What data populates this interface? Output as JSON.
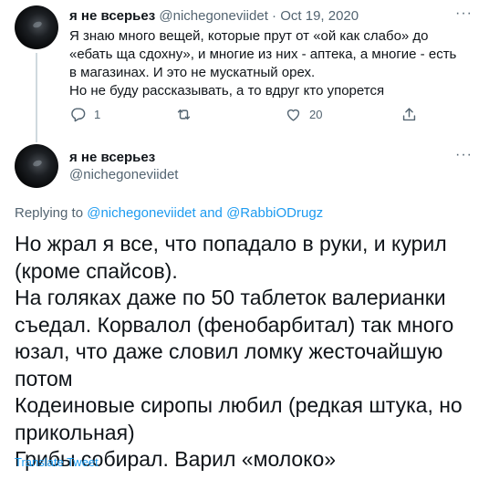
{
  "tweet1": {
    "avatar": "avatar",
    "name": "я не всерьез",
    "handle": "@nichegoneviidet",
    "separator": "·",
    "date": "Oct 19, 2020",
    "text_lines": [
      "Я знаю много вещей, которые прут от «ой как слабо» до",
      "«ебать ща сдохну», и многие из них - аптека, а многие - есть",
      "в магазинах. И это не мускатный орех.",
      "Но не буду рассказывать, а то вдруг кто упорется"
    ],
    "actions": {
      "reply_count": "1",
      "retweet_count": "",
      "like_count": "20"
    },
    "more": "···"
  },
  "tweet2": {
    "avatar": "avatar",
    "name": "я не всерьез",
    "handle": "@nichegoneviidet",
    "more": "···",
    "replying": {
      "prefix": "Replying to ",
      "user1": "@nichegoneviidet",
      "and": " and ",
      "user2": "@RabbiODrugz"
    },
    "text_lines": [
      "Но жрал я все, что попадало в руки, и курил",
      "(кроме спайсов).",
      "На голяках даже по 50 таблеток валерианки",
      "съедал. Корвалол (фенобарбитал) так много",
      "юзал, что даже словил ломку жесточайшую",
      "потом",
      "Кодеиновые сиропы любил (редкая штука, но",
      "прикольная)",
      "Грибы собирал. Варил «молоко»"
    ],
    "translate": "Translate Tweet"
  },
  "colors": {
    "text": "#0f1419",
    "muted": "#536471",
    "link": "#1d9bf0",
    "thread_line": "#cfd9de"
  },
  "icons": {
    "reply": "reply-icon",
    "retweet": "retweet-icon",
    "like": "heart-icon",
    "share": "share-icon",
    "more": "more-icon"
  }
}
